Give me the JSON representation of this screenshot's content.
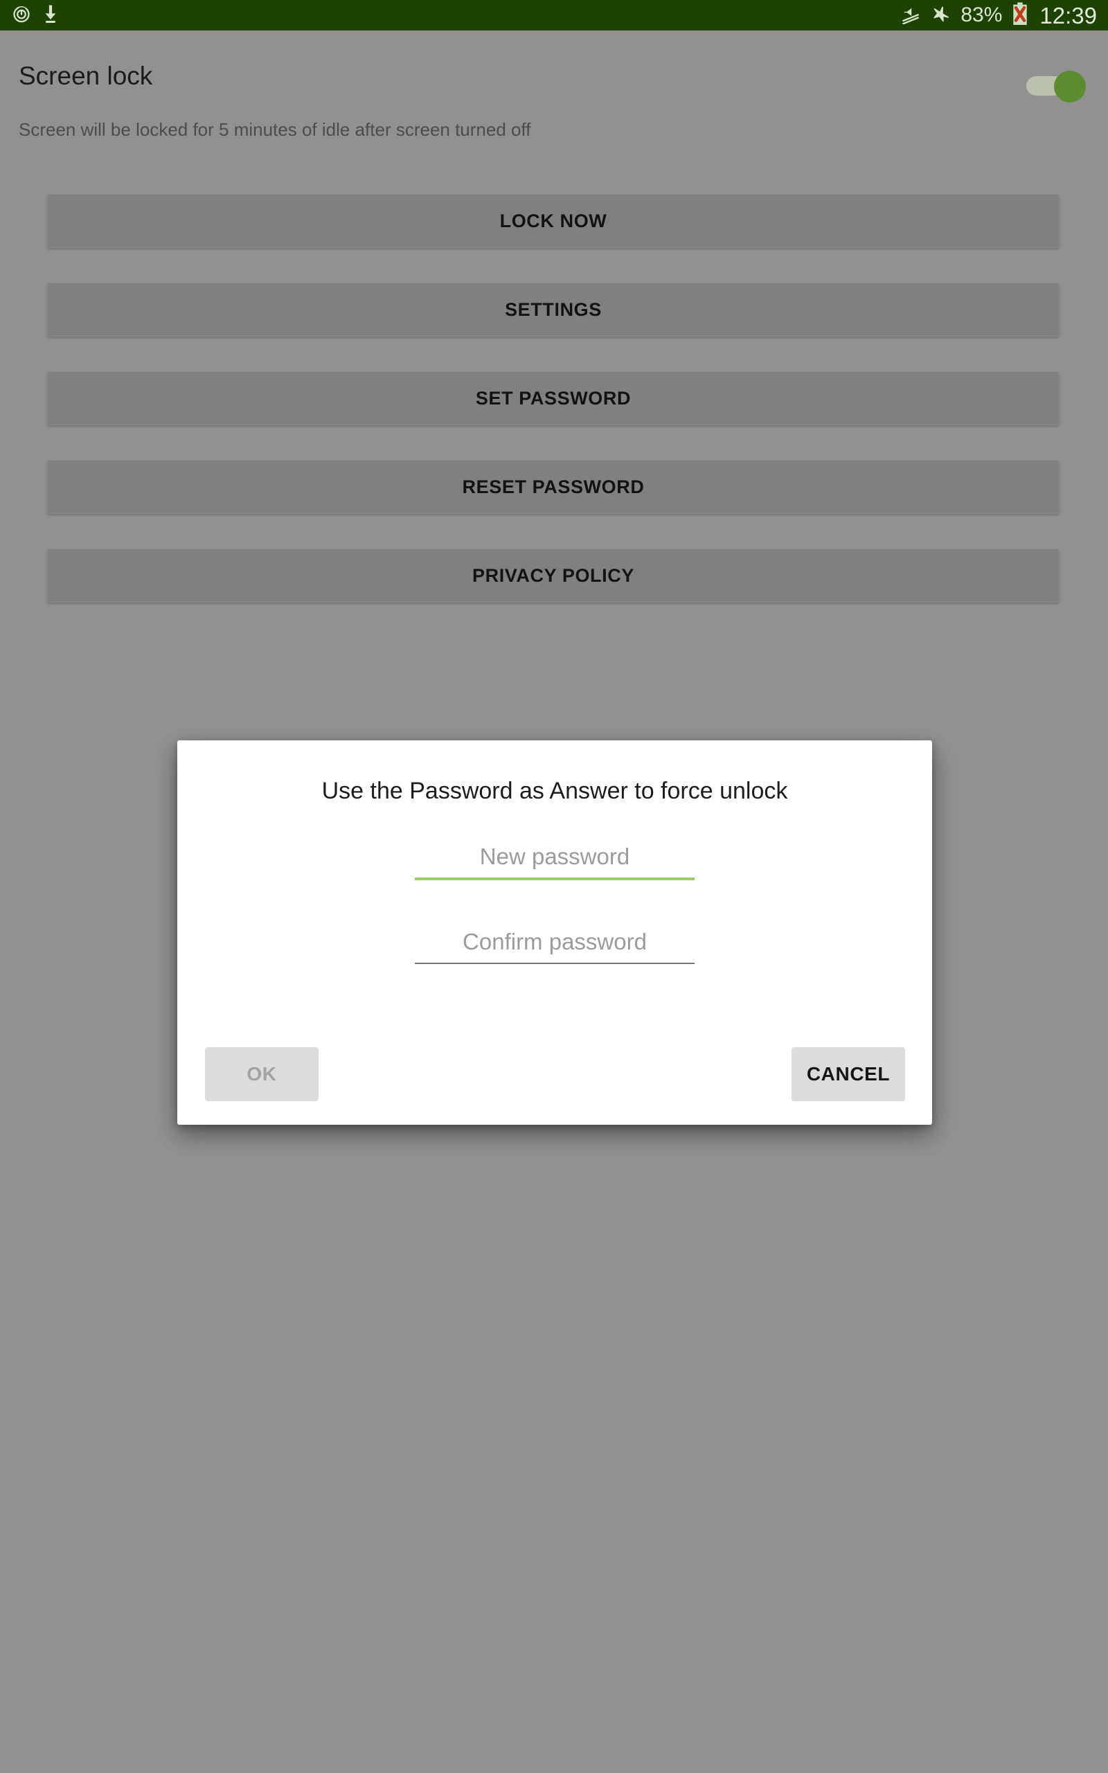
{
  "status_bar": {
    "background_color": "#1e4203",
    "left_icons": [
      {
        "name": "alarm-clock-icon",
        "label": "alarm"
      },
      {
        "name": "download-icon",
        "label": "download"
      }
    ],
    "right_icons": [
      {
        "name": "mute-icon",
        "label": "silent mode"
      },
      {
        "name": "airplane-mode-icon",
        "label": "airplane mode"
      }
    ],
    "battery_percent": "83%",
    "battery_state_icon": "battery-error-icon",
    "clock": "12:39"
  },
  "header": {
    "title": "Screen lock",
    "toggle": {
      "name": "screen-lock-toggle",
      "state": "on",
      "track_color": "#b9c0ac",
      "thumb_color": "#5d8c30"
    }
  },
  "subtitle": "Screen will be locked for 5 minutes of idle after screen turned off",
  "buttons": [
    {
      "id": "lock-now",
      "label": "LOCK NOW"
    },
    {
      "id": "settings",
      "label": "SETTINGS"
    },
    {
      "id": "set-password",
      "label": "SET PASSWORD"
    },
    {
      "id": "reset-password",
      "label": "RESET PASSWORD"
    },
    {
      "id": "privacy-policy",
      "label": "PRIVACY POLICY"
    }
  ],
  "dialog": {
    "title": "Use the Password as Answer to force unlock",
    "fields": [
      {
        "id": "new-password",
        "placeholder": "New password",
        "value": "",
        "focused": true,
        "underline_color": "#9ccc65"
      },
      {
        "id": "confirm-password",
        "placeholder": "Confirm password",
        "value": "",
        "focused": false,
        "underline_color": "#757575"
      }
    ],
    "ok_label": "OK",
    "ok_enabled": false,
    "cancel_label": "CANCEL"
  },
  "colors": {
    "page_background": "#919191",
    "button_fill": "#808080",
    "status_bar": "#1e4203",
    "accent_green": "#9ccc65",
    "dialog_background": "#ffffff",
    "dialog_button_fill": "#dcdcdc"
  }
}
